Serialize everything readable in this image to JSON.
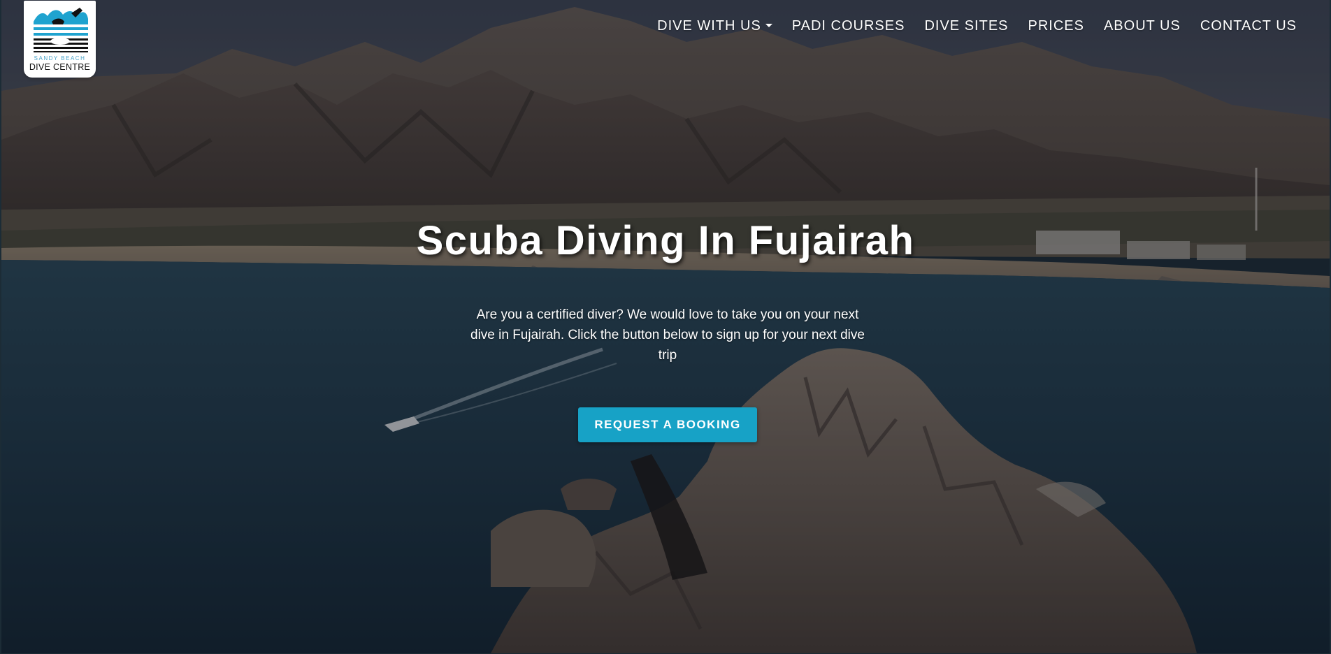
{
  "brand": {
    "logo_line1": "SANDY BEACH",
    "logo_line2": "DIVE CENTRE",
    "accent_color": "#17a2c6"
  },
  "nav": {
    "items": [
      {
        "label": "DIVE WITH US",
        "has_dropdown": true
      },
      {
        "label": "PADI COURSES"
      },
      {
        "label": "DIVE SITES"
      },
      {
        "label": "PRICES"
      },
      {
        "label": "ABOUT US"
      },
      {
        "label": "CONTACT US"
      }
    ],
    "dropdown_icon": "caret-down-icon"
  },
  "hero": {
    "title": "Scuba Diving In Fujairah",
    "description": "Are you a certified diver? We would love to take you on your next dive in Fujairah. Click the button below to sign up for your next dive trip",
    "cta_label": "REQUEST A BOOKING"
  }
}
